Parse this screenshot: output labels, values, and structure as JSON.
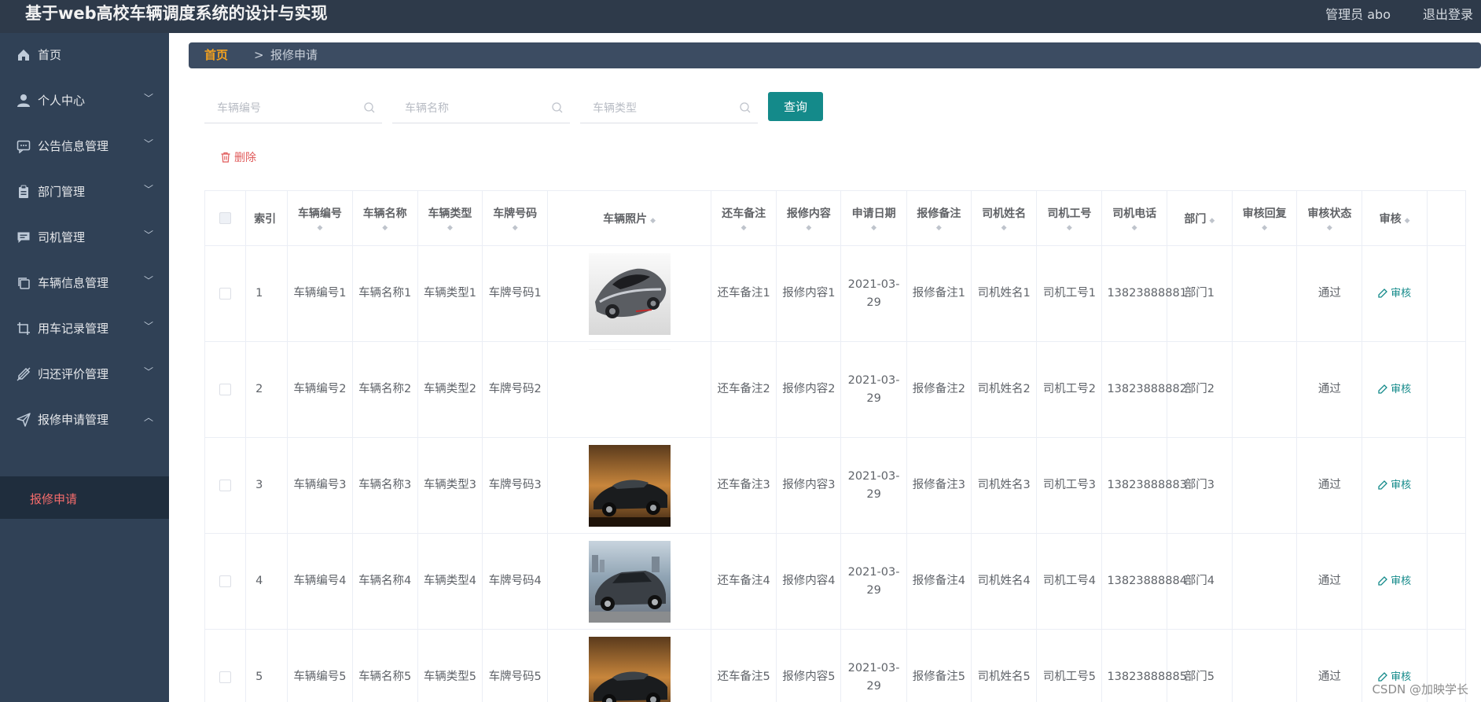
{
  "header": {
    "title": "基于web高校车辆调度系统的设计与实现",
    "user": "管理员 abo",
    "logout": "退出登录"
  },
  "sidebar": {
    "items": [
      {
        "label": "首页",
        "icon": "home-icon",
        "arrow": ""
      },
      {
        "label": "个人中心",
        "icon": "user-icon",
        "arrow": "﹀"
      },
      {
        "label": "公告信息管理",
        "icon": "message-icon",
        "arrow": "﹀"
      },
      {
        "label": "部门管理",
        "icon": "clipboard-icon",
        "arrow": "﹀"
      },
      {
        "label": "司机管理",
        "icon": "chat-icon",
        "arrow": "﹀"
      },
      {
        "label": "车辆信息管理",
        "icon": "copy-icon",
        "arrow": "﹀"
      },
      {
        "label": "用车记录管理",
        "icon": "crop-icon",
        "arrow": "﹀"
      },
      {
        "label": "归还评价管理",
        "icon": "edit-off-icon",
        "arrow": "﹀"
      },
      {
        "label": "报修申请管理",
        "icon": "send-icon",
        "arrow": "︿"
      }
    ],
    "active_sub": "报修申请"
  },
  "breadcrumb": {
    "home": "首页",
    "sep": ">",
    "current": "报修申请"
  },
  "search": {
    "vehicle_no_placeholder": "车辆编号",
    "vehicle_name_placeholder": "车辆名称",
    "vehicle_type_placeholder": "车辆类型",
    "query_label": "查询"
  },
  "actions": {
    "delete_label": "删除"
  },
  "table": {
    "headers": [
      "索引",
      "车辆编号",
      "车辆名称",
      "车辆类型",
      "车牌号码",
      "车辆照片",
      "还车备注",
      "报修内容",
      "申请日期",
      "报修备注",
      "司机姓名",
      "司机工号",
      "司机电话",
      "部门",
      "审核回复",
      "审核状态",
      "审核"
    ],
    "review_label": "审核",
    "rows": [
      {
        "index": "1",
        "vehicle_no": "车辆编号1",
        "vehicle_name": "车辆名称1",
        "vehicle_type": "车辆类型1",
        "plate": "车牌号码1",
        "photo": "silver-sports-car",
        "return_note": "还车备注1",
        "repair_content": "报修内容1",
        "date": "2021-03-29",
        "repair_note": "报修备注1",
        "driver_name": "司机姓名1",
        "driver_no": "司机工号1",
        "phone": "13823888881",
        "dept": "部门1",
        "reply": "",
        "status": "通过"
      },
      {
        "index": "2",
        "vehicle_no": "车辆编号2",
        "vehicle_name": "车辆名称2",
        "vehicle_type": "车辆类型2",
        "plate": "车牌号码2",
        "photo": "none",
        "return_note": "还车备注2",
        "repair_content": "报修内容2",
        "date": "2021-03-29",
        "repair_note": "报修备注2",
        "driver_name": "司机姓名2",
        "driver_no": "司机工号2",
        "phone": "13823888882",
        "dept": "部门2",
        "reply": "",
        "status": "通过"
      },
      {
        "index": "3",
        "vehicle_no": "车辆编号3",
        "vehicle_name": "车辆名称3",
        "vehicle_type": "车辆类型3",
        "plate": "车牌号码3",
        "photo": "dark-car-sunset",
        "return_note": "还车备注3",
        "repair_content": "报修内容3",
        "date": "2021-03-29",
        "repair_note": "报修备注3",
        "driver_name": "司机姓名3",
        "driver_no": "司机工号3",
        "phone": "13823888883",
        "dept": "部门3",
        "reply": "",
        "status": "通过"
      },
      {
        "index": "4",
        "vehicle_no": "车辆编号4",
        "vehicle_name": "车辆名称4",
        "vehicle_type": "车辆类型4",
        "plate": "车牌号码4",
        "photo": "grey-sedan-harbor",
        "return_note": "还车备注4",
        "repair_content": "报修内容4",
        "date": "2021-03-29",
        "repair_note": "报修备注4",
        "driver_name": "司机姓名4",
        "driver_no": "司机工号4",
        "phone": "13823888884",
        "dept": "部门4",
        "reply": "",
        "status": "通过"
      },
      {
        "index": "5",
        "vehicle_no": "车辆编号5",
        "vehicle_name": "车辆名称5",
        "vehicle_type": "车辆类型5",
        "plate": "车牌号码5",
        "photo": "dark-car-sunset",
        "return_note": "还车备注5",
        "repair_content": "报修内容5",
        "date": "2021-03-29",
        "repair_note": "报修备注5",
        "driver_name": "司机姓名5",
        "driver_no": "司机工号5",
        "phone": "13823888885",
        "dept": "部门5",
        "reply": "",
        "status": "通过"
      }
    ]
  },
  "watermark": "CSDN @加映学长",
  "colors": {
    "sidebar_bg": "#304156",
    "topbar_bg": "#2e3a4a",
    "accent": "#148a8a",
    "danger": "#e05a5a",
    "breadcrumb_home": "#f0a020"
  }
}
